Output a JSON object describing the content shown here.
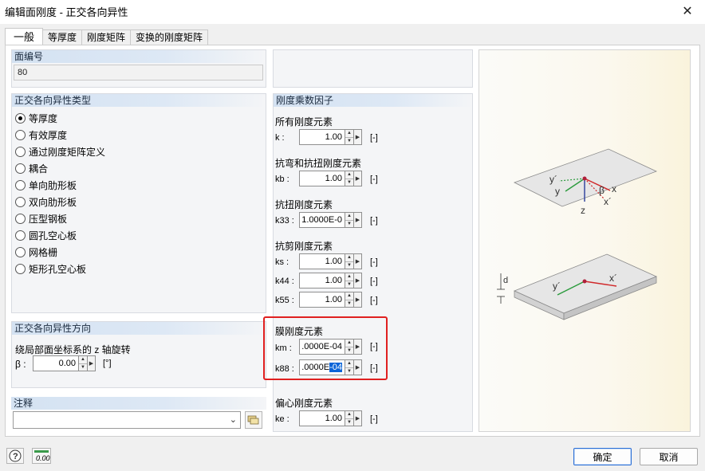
{
  "window": {
    "title": "编辑面刚度 - 正交各向异性"
  },
  "tabs": [
    {
      "label": "一般",
      "active": true
    },
    {
      "label": "等厚度",
      "active": false
    },
    {
      "label": "刚度矩阵",
      "active": false
    },
    {
      "label": "变换的刚度矩阵",
      "active": false
    }
  ],
  "surface_no": {
    "header": "面编号",
    "value": "80"
  },
  "ortho_type": {
    "header": "正交各向异性类型",
    "options": [
      {
        "label": "等厚度",
        "checked": true
      },
      {
        "label": "有效厚度",
        "checked": false
      },
      {
        "label": "通过刚度矩阵定义",
        "checked": false
      },
      {
        "label": "耦合",
        "checked": false
      },
      {
        "label": "单向肋形板",
        "checked": false
      },
      {
        "label": "双向肋形板",
        "checked": false
      },
      {
        "label": "压型钢板",
        "checked": false
      },
      {
        "label": "圆孔空心板",
        "checked": false
      },
      {
        "label": "网格栅",
        "checked": false
      },
      {
        "label": "矩形孔空心板",
        "checked": false
      }
    ]
  },
  "ortho_direction": {
    "header": "正交各向异性方向",
    "rotation_label": "绕局部面坐标系的 z 轴旋转",
    "beta_label": "β :",
    "beta_value": "0.00",
    "beta_unit": "[°]"
  },
  "comment": {
    "header": "注释",
    "value": ""
  },
  "stiffness": {
    "header": "刚度乘数因子",
    "all": {
      "title": "所有刚度元素",
      "k_label": "k :",
      "k_value": "1.00",
      "unit": "[-]"
    },
    "bending": {
      "title": "抗弯和抗扭刚度元素",
      "kb_label": "kb :",
      "kb_value": "1.00",
      "unit": "[-]"
    },
    "torsion": {
      "title": "抗扭刚度元素",
      "k33_label": "k33 :",
      "k33_value": "1.0000E-0",
      "unit": "[-]"
    },
    "shear": {
      "title": "抗剪刚度元素",
      "ks_label": "ks :",
      "ks_value": "1.00",
      "k44_label": "k44 :",
      "k44_value": "1.00",
      "k55_label": "k55 :",
      "k55_value": "1.00",
      "unit": "[-]"
    },
    "membrane": {
      "title": "膜刚度元素",
      "km_label": "km :",
      "km_value": ".0000E-04",
      "k88_label": "k88 :",
      "k88_value_pre": ".0000E",
      "k88_value_sel": "-04",
      "unit": "[-]"
    },
    "eccentric": {
      "title": "偏心刚度元素",
      "ke_label": "ke :",
      "ke_value": "1.00",
      "unit": "[-]"
    }
  },
  "preview": {
    "labels": {
      "y_prime": "y´",
      "y": "y",
      "x": "x",
      "x_prime": "x´",
      "z": "z",
      "beta": "β",
      "d": "d",
      "y_prime2": "y´",
      "x_prime2": "x´"
    },
    "colors": {
      "x_axis": "#d0282a",
      "y_axis": "#2a9a3c",
      "z_axis": "#2a3c9a",
      "point": "#b0203a"
    }
  },
  "footer": {
    "help_icon": "help-icon",
    "units_icon": "decimal-places-icon",
    "units_text": "0.00",
    "ok_label": "确定",
    "cancel_label": "取消"
  }
}
